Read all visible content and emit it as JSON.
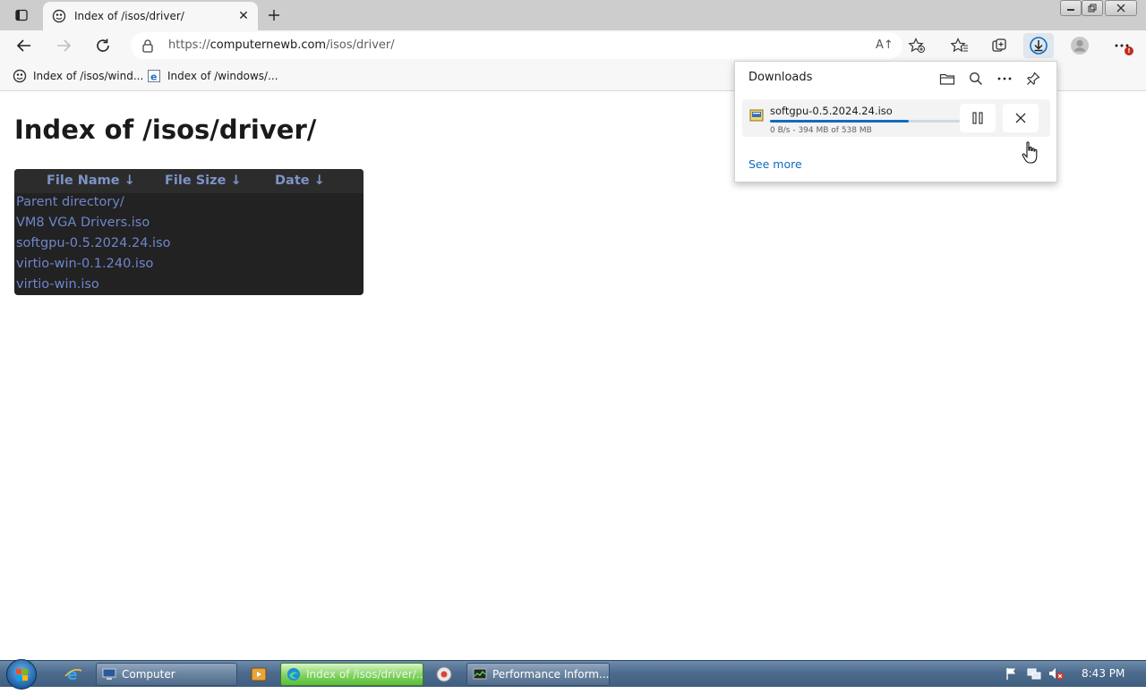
{
  "browser": {
    "tab": {
      "title": "Index of /isos/driver/"
    },
    "address": {
      "prefix": "https://",
      "host": "computernewb.com",
      "path": "/isos/driver/"
    },
    "favorites": [
      {
        "label": "Index of /isos/wind..."
      },
      {
        "label": "Index of /windows/..."
      }
    ],
    "read_aloud_glyph": "A↑"
  },
  "page": {
    "heading": "Index of /isos/driver/",
    "columns": [
      "File Name  ↓",
      "File Size  ↓",
      "Date  ↓"
    ],
    "rows": [
      {
        "name": "Parent directory/",
        "size": "",
        "date": ""
      },
      {
        "name": "VM8 VGA Drivers.iso",
        "size": "",
        "date": ""
      },
      {
        "name": "softgpu-0.5.2024.24.iso",
        "size": "",
        "date": ""
      },
      {
        "name": "virtio-win-0.1.240.iso",
        "size": "",
        "date": ""
      },
      {
        "name": "virtio-win.iso",
        "size": "",
        "date": ""
      }
    ]
  },
  "downloads": {
    "title": "Downloads",
    "item": {
      "filename": "softgpu-0.5.2024.24.iso",
      "status": "0 B/s - 394 MB of 538 MB",
      "progress_fraction": 0.73
    },
    "see_more": "See more"
  },
  "taskbar": {
    "buttons": [
      {
        "label": "Computer"
      },
      {
        "label": "Index of /isos/driver/..."
      },
      {
        "label": "Performance Inform..."
      }
    ],
    "clock": "8:43 PM"
  },
  "colors": {
    "accent": "#0f6cbd",
    "link": "#6f86cd",
    "table_bg": "#222222"
  }
}
